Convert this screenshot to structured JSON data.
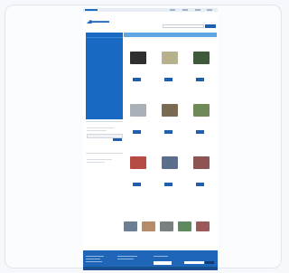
{
  "header": {
    "top_links": [
      "",
      "",
      "",
      ""
    ],
    "search_placeholder": ""
  },
  "sidebar": {
    "items": [
      "",
      "",
      "",
      "",
      "",
      "",
      "",
      "",
      "",
      "",
      "",
      "",
      "",
      "",
      "",
      "",
      "",
      ""
    ],
    "newsletter_title": "",
    "info_title": ""
  },
  "breadcrumb": {
    "items": [
      "",
      "",
      ""
    ]
  },
  "main": {
    "section_title": "",
    "products": [
      {
        "name": "",
        "price": "",
        "color": "#2f2f2f"
      },
      {
        "name": "",
        "price": "",
        "color": "#b7b18d"
      },
      {
        "name": "",
        "price": "",
        "color": "#3f5a3a"
      },
      {
        "name": "",
        "price": "",
        "color": "#a9b0b8"
      },
      {
        "name": "",
        "price": "",
        "color": "#7a6a52"
      },
      {
        "name": "",
        "price": "",
        "color": "#6f8a58"
      },
      {
        "name": "",
        "price": "",
        "color": "#b64a44"
      },
      {
        "name": "",
        "price": "",
        "color": "#5b6f8c"
      },
      {
        "name": "",
        "price": "",
        "color": "#8e5454"
      }
    ],
    "thumbs_title": "",
    "thumb_colors": [
      "#6b7f93",
      "#b58b6a",
      "#7a7f7f",
      "#5f8a5f",
      "#9a5a5a"
    ]
  },
  "footer": {
    "columns": [
      "",
      "",
      "",
      ""
    ]
  },
  "colors": {
    "primary": "#1769c2",
    "button": "#1f5fae",
    "breadcrumb": "#5ea7e3",
    "price_red": "#c0392b"
  }
}
